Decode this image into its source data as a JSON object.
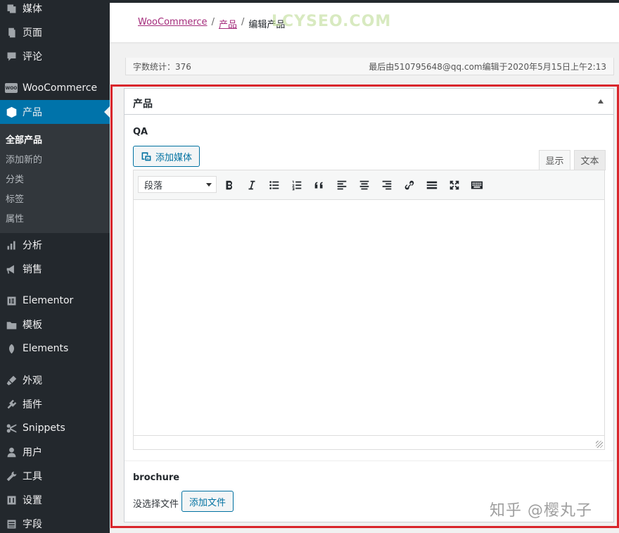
{
  "sidebar": {
    "items": [
      {
        "label": "媒体",
        "icon": "media-icon"
      },
      {
        "label": "页面",
        "icon": "pages-icon"
      },
      {
        "label": "评论",
        "icon": "comments-icon"
      },
      {
        "label": "WooCommerce",
        "icon": "woo-icon"
      },
      {
        "label": "产品",
        "icon": "products-icon"
      },
      {
        "label": "分析",
        "icon": "analytics-icon"
      },
      {
        "label": "销售",
        "icon": "marketing-icon"
      },
      {
        "label": "Elementor",
        "icon": "elementor-icon"
      },
      {
        "label": "模板",
        "icon": "templates-icon"
      },
      {
        "label": "Elements",
        "icon": "elements-icon"
      },
      {
        "label": "外观",
        "icon": "appearance-icon"
      },
      {
        "label": "插件",
        "icon": "plugins-icon"
      },
      {
        "label": "Snippets",
        "icon": "snippets-icon"
      },
      {
        "label": "用户",
        "icon": "users-icon"
      },
      {
        "label": "工具",
        "icon": "tools-icon"
      },
      {
        "label": "设置",
        "icon": "settings-icon"
      },
      {
        "label": "字段",
        "icon": "fields-icon"
      }
    ],
    "woo_badge": "WOO",
    "submenu": [
      {
        "label": "全部产品",
        "current": true
      },
      {
        "label": "添加新的"
      },
      {
        "label": "分类"
      },
      {
        "label": "标签"
      },
      {
        "label": "属性"
      }
    ],
    "accent_color": "#0073aa"
  },
  "breadcrumb": {
    "items": [
      "WooCommerce",
      "产品",
      "编辑产品"
    ],
    "separator": "/"
  },
  "watermark": "LCYSEO.COM",
  "status_bar": {
    "word_count": "字数统计：376",
    "last_edited": "最后由510795648@qq.com编辑于2020年5月15日上午2:13"
  },
  "panel": {
    "title": "产品",
    "qa_label": "QA",
    "add_media": "添加媒体",
    "tabs": {
      "visual": "显示",
      "text": "文本"
    },
    "format_select": "段落",
    "toolbar_buttons": [
      "bold-icon",
      "italic-icon",
      "bullet-list-icon",
      "numbered-list-icon",
      "blockquote-icon",
      "align-left-icon",
      "align-center-icon",
      "align-right-icon",
      "link-icon",
      "read-more-icon",
      "fullscreen-icon",
      "toolbar-toggle-icon"
    ],
    "brochure_label": "brochure",
    "no_file": "没选择文件",
    "add_file": "添加文件"
  },
  "highlight_color": "#d9262c",
  "zhihu_mark": "知乎 @樱丸子"
}
